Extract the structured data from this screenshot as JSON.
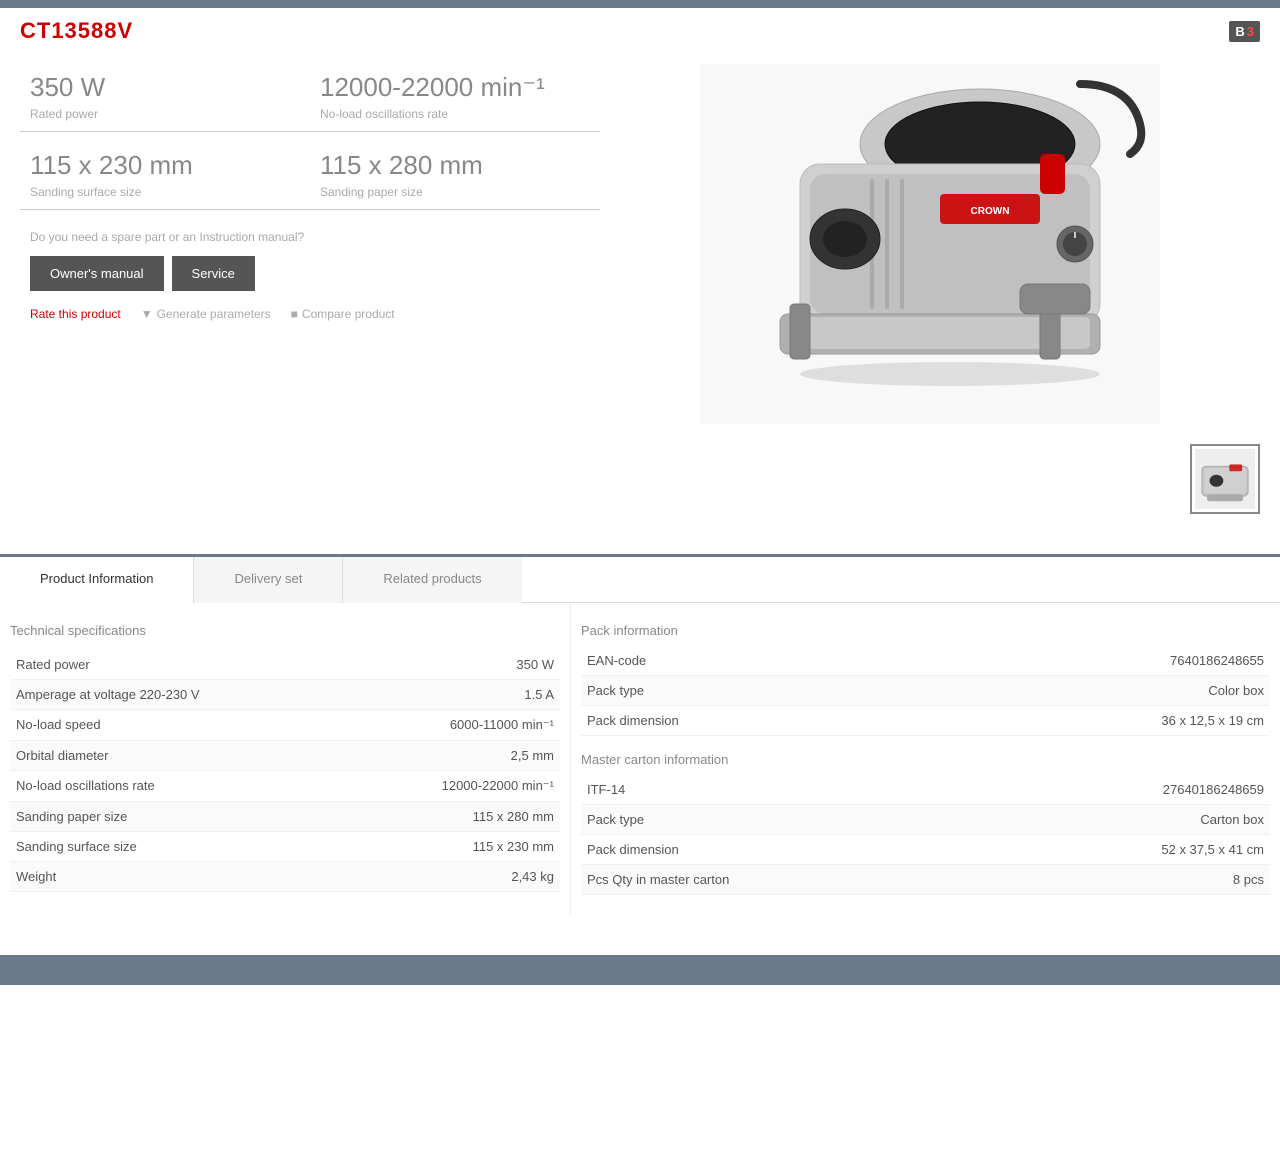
{
  "header": {
    "title": "CT13588V",
    "badge": "B",
    "badge_num": "3"
  },
  "specs": [
    {
      "value": "350 W",
      "label": "Rated power"
    },
    {
      "value": "12000-22000 min⁻¹",
      "label": "No-load oscillations rate"
    },
    {
      "value": "115 x 230 mm",
      "label": "Sanding surface size"
    },
    {
      "value": "115 x 280 mm",
      "label": "Sanding paper size"
    }
  ],
  "info": {
    "question": "Do you need a spare part or an Instruction manual?",
    "owners_manual_btn": "Owner's manual",
    "service_btn": "Service",
    "rate_link": "Rate this product",
    "generate_link": "Generate parameters",
    "compare_link": "Compare product"
  },
  "tabs": [
    {
      "label": "Product Information",
      "active": true
    },
    {
      "label": "Delivery set",
      "active": false
    },
    {
      "label": "Related products",
      "active": false
    }
  ],
  "technical_specs": {
    "section_title": "Technical specifications",
    "rows": [
      {
        "label": "Rated power",
        "value": "350 W"
      },
      {
        "label": "Amperage at voltage 220-230 V",
        "value": "1.5 A"
      },
      {
        "label": "No-load speed",
        "value": "6000-11000 min⁻¹"
      },
      {
        "label": "Orbital diameter",
        "value": "2,5 mm"
      },
      {
        "label": "No-load oscillations rate",
        "value": "12000-22000 min⁻¹"
      },
      {
        "label": "Sanding paper size",
        "value": "115 x 280 mm"
      },
      {
        "label": "Sanding surface size",
        "value": "115 x 230 mm"
      },
      {
        "label": "Weight",
        "value": "2,43 kg"
      }
    ]
  },
  "pack_info": {
    "pack_section_title": "Pack information",
    "pack_rows": [
      {
        "label": "EAN-code",
        "value": "7640186248655"
      },
      {
        "label": "Pack type",
        "value": "Color box"
      },
      {
        "label": "Pack dimension",
        "value": "36 x 12,5 x 19 cm"
      }
    ],
    "master_section_title": "Master carton information",
    "master_rows": [
      {
        "label": "ITF-14",
        "value": "27640186248659"
      },
      {
        "label": "Pack type",
        "value": "Carton box"
      },
      {
        "label": "Pack dimension",
        "value": "52 x 37,5 x 41 cm"
      },
      {
        "label": "Pcs Qty in master carton",
        "value": "8 pcs"
      }
    ]
  }
}
